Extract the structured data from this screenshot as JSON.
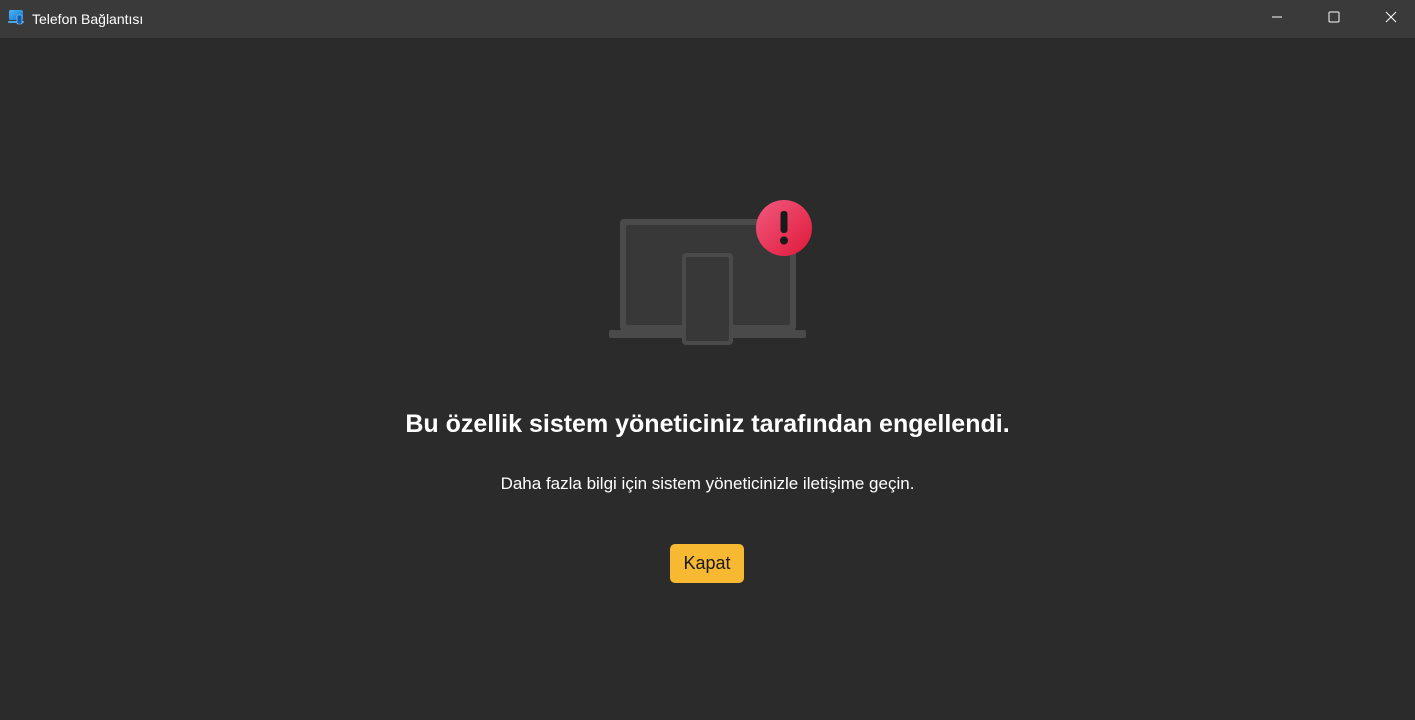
{
  "window": {
    "title": "Telefon Bağlantısı",
    "app_icon": "phone-link-app-icon",
    "controls": {
      "minimize_icon": "minimize-icon",
      "maximize_icon": "maximize-icon",
      "close_icon": "close-icon"
    }
  },
  "main": {
    "illustration_icon": "laptop-phone-blocked-illustration",
    "alert_icon": "exclamation-alert-icon",
    "heading": "Bu özellik sistem yöneticiniz tarafından engellendi.",
    "message": "Daha fazla bilgi için sistem yöneticinizle iletişime geçin.",
    "close_button_label": "Kapat"
  },
  "colors": {
    "background": "#2b2b2b",
    "titlebar": "#3a3a3a",
    "accent_button": "#f7b832",
    "alert_red": "#e8294c"
  }
}
